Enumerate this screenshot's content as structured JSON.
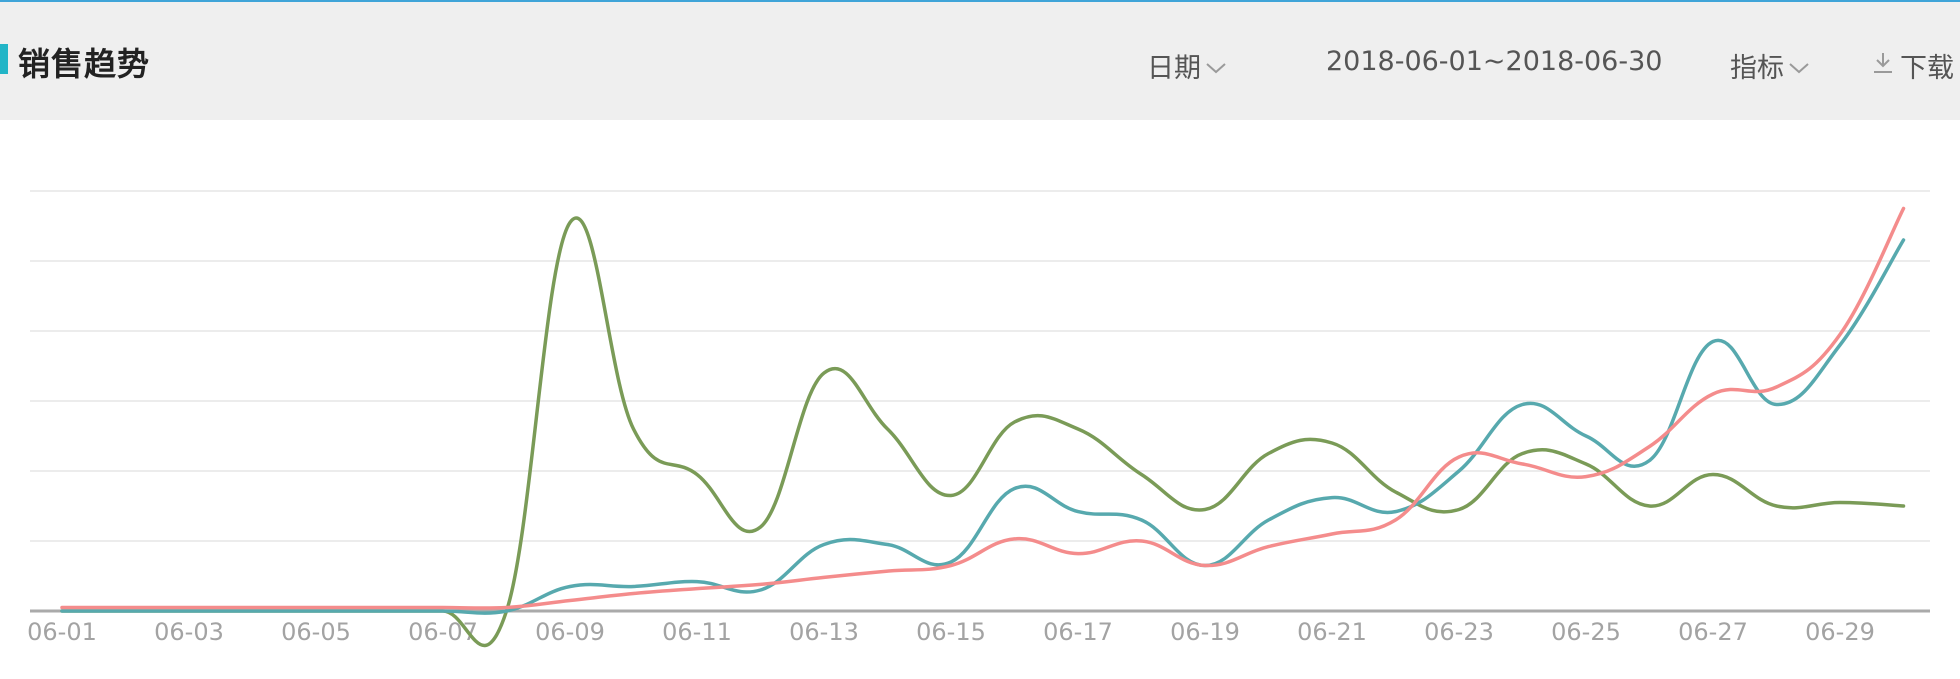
{
  "header": {
    "title": "销售趋势",
    "date_label": "日期",
    "date_range": "2018-06-01~2018-06-30",
    "metric_label": "指标",
    "download_label": "下载"
  },
  "colors": {
    "accent": "#22b5c7",
    "series_green": "#7a9b57",
    "series_teal": "#57a9ae",
    "series_pink": "#f48c8c"
  },
  "chart_data": {
    "type": "line",
    "title": "",
    "xlabel": "",
    "ylabel": "",
    "x": [
      "06-01",
      "06-02",
      "06-03",
      "06-04",
      "06-05",
      "06-06",
      "06-07",
      "06-08",
      "06-09",
      "06-10",
      "06-11",
      "06-12",
      "06-13",
      "06-14",
      "06-15",
      "06-16",
      "06-17",
      "06-18",
      "06-19",
      "06-20",
      "06-21",
      "06-22",
      "06-23",
      "06-24",
      "06-25",
      "06-26",
      "06-27",
      "06-28",
      "06-29",
      "06-30"
    ],
    "tick_labels": [
      "06-01",
      "06-03",
      "06-05",
      "06-07",
      "06-09",
      "06-11",
      "06-13",
      "06-15",
      "06-17",
      "06-19",
      "06-21",
      "06-23",
      "06-25",
      "06-27",
      "06-29"
    ],
    "ylim": [
      0,
      6
    ],
    "y_ticks_visible": false,
    "grid": true,
    "legend": "none",
    "series": [
      {
        "color": "#7a9b57",
        "values": [
          0,
          0,
          0,
          0,
          0,
          0,
          0,
          0,
          5.55,
          2.6,
          1.95,
          1.2,
          3.4,
          2.6,
          1.65,
          2.7,
          2.6,
          1.95,
          1.45,
          2.25,
          2.4,
          1.7,
          1.45,
          2.25,
          2.1,
          1.5,
          1.95,
          1.5,
          1.55,
          1.5
        ]
      },
      {
        "color": "#57a9ae",
        "values": [
          0,
          0,
          0,
          0,
          0,
          0,
          0,
          0,
          0.35,
          0.35,
          0.42,
          0.3,
          0.95,
          0.95,
          0.7,
          1.75,
          1.42,
          1.3,
          0.65,
          1.3,
          1.62,
          1.42,
          2.0,
          2.95,
          2.5,
          2.15,
          3.85,
          2.95,
          3.8,
          5.3
        ]
      },
      {
        "color": "#f48c8c",
        "values": [
          0.05,
          0.05,
          0.05,
          0.05,
          0.05,
          0.05,
          0.05,
          0.05,
          0.15,
          0.25,
          0.32,
          0.38,
          0.48,
          0.57,
          0.65,
          1.03,
          0.82,
          1.0,
          0.65,
          0.92,
          1.1,
          1.3,
          2.2,
          2.1,
          1.92,
          2.35,
          3.1,
          3.2,
          3.95,
          5.75
        ]
      }
    ]
  }
}
